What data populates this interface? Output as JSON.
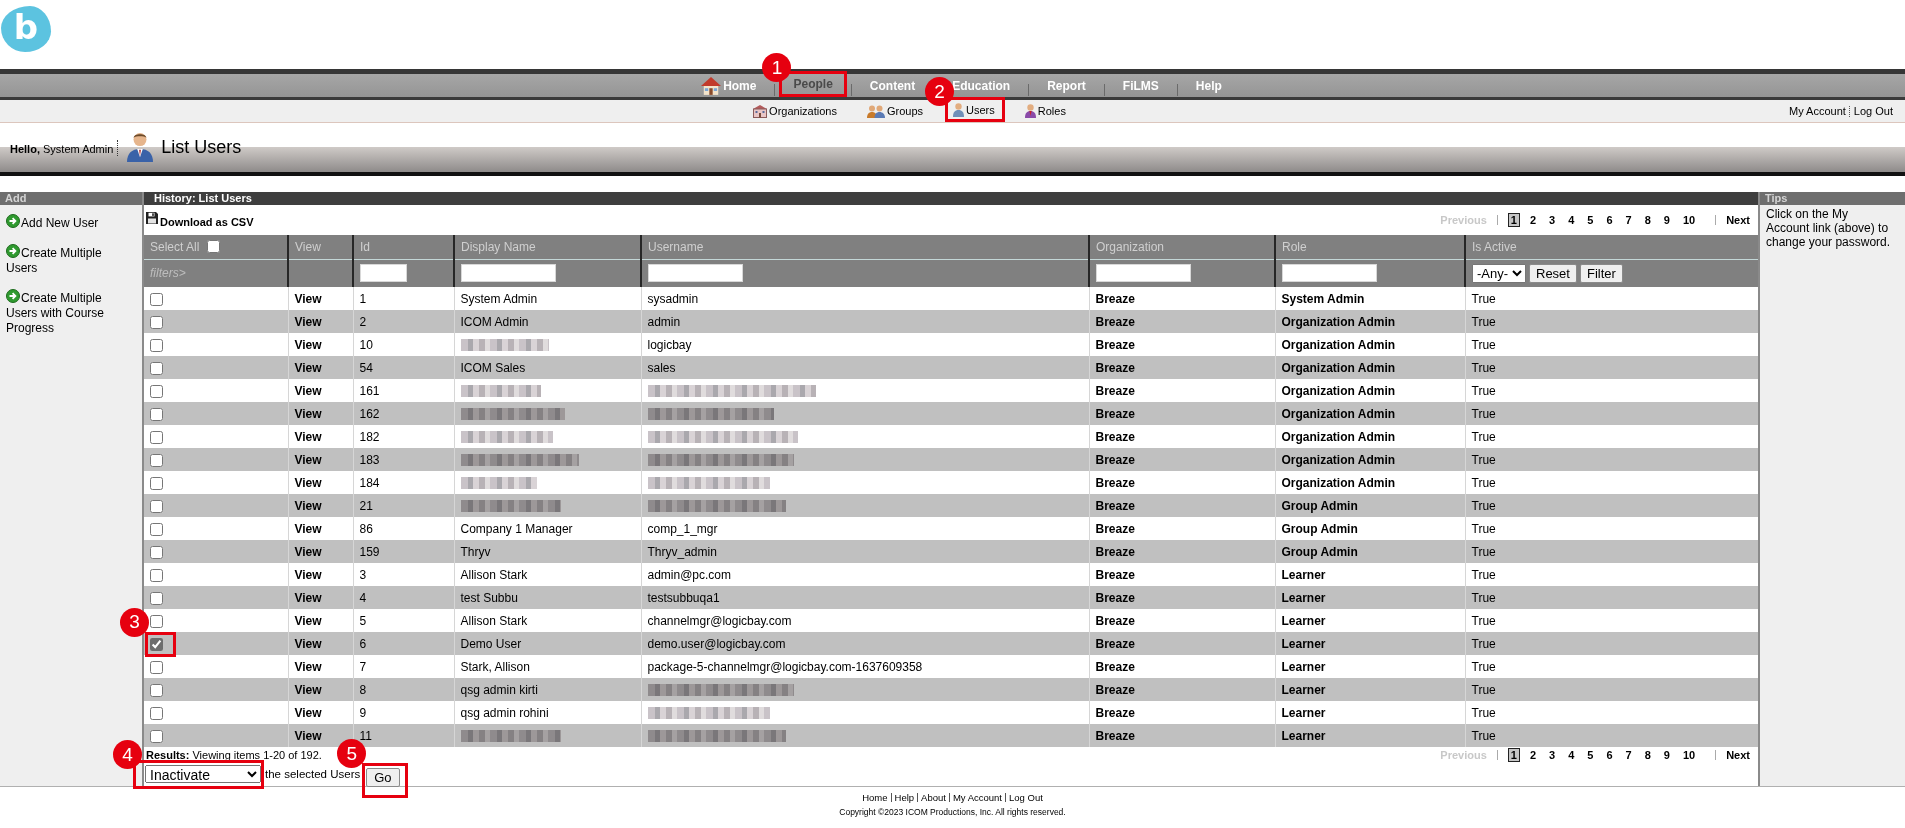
{
  "logo": {
    "letter": "b"
  },
  "nav": {
    "items": [
      {
        "label": "Home",
        "selected": false
      },
      {
        "label": "People",
        "selected": true,
        "callout": "1"
      },
      {
        "label": "Content",
        "selected": false
      },
      {
        "label": "Education",
        "selected": false
      },
      {
        "label": "Report",
        "selected": false
      },
      {
        "label": "FiLMS",
        "selected": false
      },
      {
        "label": "Help",
        "selected": false
      }
    ]
  },
  "subnav": {
    "items": [
      {
        "label": "Organizations"
      },
      {
        "label": "Groups"
      },
      {
        "label": "Users",
        "callout": "2"
      },
      {
        "label": "Roles"
      }
    ],
    "account_links": [
      "My Account",
      "Log Out"
    ]
  },
  "header": {
    "greeting": "**Hello,** System Admin",
    "title": "List Users"
  },
  "sidebar": {
    "title": "Add",
    "links": [
      "Add New User",
      "Create Multiple Users",
      "Create Multiple Users with Course Progress"
    ]
  },
  "content": {
    "history": "History: List Users",
    "download": "Download as CSV",
    "pagination_top": {
      "previous": "Previous",
      "previous_disabled": true,
      "pages": [
        {
          "label": "1",
          "selected": true
        },
        {
          "label": "2",
          "selected": false
        },
        {
          "label": "3",
          "selected": false
        },
        {
          "label": "4",
          "selected": false
        },
        {
          "label": "5",
          "selected": false
        },
        {
          "label": "6",
          "selected": false
        },
        {
          "label": "7",
          "selected": false
        },
        {
          "label": "8",
          "selected": false
        },
        {
          "label": "9",
          "selected": false
        },
        {
          "label": "10",
          "selected": false
        }
      ],
      "next": "Next"
    },
    "table": {
      "columns": [
        {
          "label": "Select All",
          "kind": "select"
        },
        {
          "label": "View",
          "kind": "text"
        },
        {
          "label": "Id",
          "kind": "text"
        },
        {
          "label": "Display Name",
          "kind": "text"
        },
        {
          "label": "Username",
          "kind": "text"
        },
        {
          "label": "Organization",
          "kind": "text"
        },
        {
          "label": "Role",
          "kind": "text"
        },
        {
          "label": "Is Active",
          "kind": "text"
        }
      ],
      "select_all_checked": false,
      "filters": [
        {
          "kind": "label",
          "text": "filters>"
        },
        {
          "kind": "blank"
        },
        {
          "kind": "input"
        },
        {
          "kind": "input"
        },
        {
          "kind": "input"
        },
        {
          "kind": "input"
        },
        {
          "kind": "input"
        },
        {
          "kind": "controls",
          "select": "-Any-",
          "buttons": [
            "Reset",
            "Filter"
          ]
        }
      ],
      "rows": [
        {
          "checked": false,
          "view": "View",
          "id": "1",
          "display_name": "System Admin",
          "name_blurred": false,
          "username": "sysadmin",
          "username_blurred": false,
          "organization": "Breaze",
          "role": "System Admin",
          "active": "True"
        },
        {
          "checked": false,
          "view": "View",
          "id": "2",
          "display_name": "ICOM Admin",
          "name_blurred": false,
          "username": "admin",
          "username_blurred": false,
          "organization": "Breaze",
          "role": "Organization Admin",
          "active": "True"
        },
        {
          "checked": false,
          "view": "View",
          "id": "10",
          "name_blurred": true,
          "username": "logicbay",
          "username_blurred": false,
          "organization": "Breaze",
          "role": "Organization Admin",
          "active": "True"
        },
        {
          "checked": false,
          "view": "View",
          "id": "54",
          "display_name": "ICOM Sales",
          "name_blurred": false,
          "username": "sales",
          "username_blurred": false,
          "organization": "Breaze",
          "role": "Organization Admin",
          "active": "True"
        },
        {
          "checked": false,
          "view": "View",
          "id": "161",
          "name_blurred": true,
          "username_blurred": true,
          "organization": "Breaze",
          "role": "Organization Admin",
          "active": "True"
        },
        {
          "checked": false,
          "view": "View",
          "id": "162",
          "name_blurred": true,
          "username_blurred": true,
          "organization": "Breaze",
          "role": "Organization Admin",
          "active": "True"
        },
        {
          "checked": false,
          "view": "View",
          "id": "182",
          "name_blurred": true,
          "username_blurred": true,
          "organization": "Breaze",
          "role": "Organization Admin",
          "active": "True"
        },
        {
          "checked": false,
          "view": "View",
          "id": "183",
          "name_blurred": true,
          "username_blurred": true,
          "organization": "Breaze",
          "role": "Organization Admin",
          "active": "True"
        },
        {
          "checked": false,
          "view": "View",
          "id": "184",
          "name_blurred": true,
          "username_blurred": true,
          "organization": "Breaze",
          "role": "Organization Admin",
          "active": "True"
        },
        {
          "checked": false,
          "view": "View",
          "id": "21",
          "name_blurred": true,
          "username_blurred": true,
          "organization": "Breaze",
          "role": "Group Admin",
          "active": "True"
        },
        {
          "checked": false,
          "view": "View",
          "id": "86",
          "display_name": "Company 1 Manager",
          "name_blurred": false,
          "username": "comp_1_mgr",
          "username_blurred": false,
          "organization": "Breaze",
          "role": "Group Admin",
          "active": "True"
        },
        {
          "checked": false,
          "view": "View",
          "id": "159",
          "display_name": "Thryv",
          "name_blurred": false,
          "username": "Thryv_admin",
          "username_blurred": false,
          "organization": "Breaze",
          "role": "Group Admin",
          "active": "True"
        },
        {
          "checked": false,
          "view": "View",
          "id": "3",
          "display_name": "Allison Stark",
          "name_blurred": false,
          "username": "admin@pc.com",
          "username_blurred": false,
          "organization": "Breaze",
          "role": "Learner",
          "active": "True"
        },
        {
          "checked": false,
          "view": "View",
          "id": "4",
          "display_name": "test Subbu",
          "name_blurred": false,
          "username": "testsubbuqa1",
          "username_blurred": false,
          "organization": "Breaze",
          "role": "Learner",
          "active": "True"
        },
        {
          "checked": false,
          "view": "View",
          "id": "5",
          "display_name": "Allison Stark",
          "name_blurred": false,
          "username": "channelmgr@logicbay.com",
          "username_blurred": false,
          "organization": "Breaze",
          "role": "Learner",
          "active": "True"
        },
        {
          "checked": true,
          "callout": "3",
          "view": "View",
          "id": "6",
          "display_name": "Demo User",
          "name_blurred": false,
          "username": "demo.user@logicbay.com",
          "username_blurred": false,
          "organization": "Breaze",
          "role": "Learner",
          "active": "True"
        },
        {
          "checked": false,
          "view": "View",
          "id": "7",
          "display_name": "Stark, Allison",
          "name_blurred": false,
          "username": "package-5-channelmgr@logicbay.com-1637609358",
          "username_blurred": false,
          "organization": "Breaze",
          "role": "Learner",
          "active": "True"
        },
        {
          "checked": false,
          "view": "View",
          "id": "8",
          "display_name": "qsg admin kirti",
          "name_blurred": false,
          "username_blurred": true,
          "organization": "Breaze",
          "role": "Learner",
          "active": "True"
        },
        {
          "checked": false,
          "view": "View",
          "id": "9",
          "display_name": "qsg admin rohini",
          "name_blurred": false,
          "username_blurred": true,
          "organization": "Breaze",
          "role": "Learner",
          "active": "True"
        },
        {
          "checked": false,
          "view": "View",
          "id": "11",
          "name_blurred": true,
          "username_blurred": true,
          "organization": "Breaze",
          "role": "Learner",
          "active": "True"
        }
      ]
    },
    "results": "**Results:** Viewing items 1-20 of 192.",
    "pagination_bottom": {
      "previous": "Previous",
      "previous_disabled": true,
      "pages": [
        {
          "label": "1",
          "selected": true
        },
        {
          "label": "2",
          "selected": false
        },
        {
          "label": "3",
          "selected": false
        },
        {
          "label": "4",
          "selected": false
        },
        {
          "label": "5",
          "selected": false
        },
        {
          "label": "6",
          "selected": false
        },
        {
          "label": "7",
          "selected": false
        },
        {
          "label": "8",
          "selected": false
        },
        {
          "label": "9",
          "selected": false
        },
        {
          "label": "10",
          "selected": false
        }
      ],
      "next": "Next"
    },
    "bulk_action": {
      "select": "Inactivate",
      "callout": "4",
      "text": "the selected Users",
      "button": "Go",
      "button_callout": "5"
    }
  },
  "tips": {
    "title": "Tips",
    "text": "Click on the My Account link (above) to change your password."
  },
  "footer": {
    "links": [
      "Home",
      "Help",
      "About",
      "My Account",
      "Log Out"
    ],
    "copyright": "Copyright ©2023 ICOM Productions, Inc. All rights reserved."
  }
}
